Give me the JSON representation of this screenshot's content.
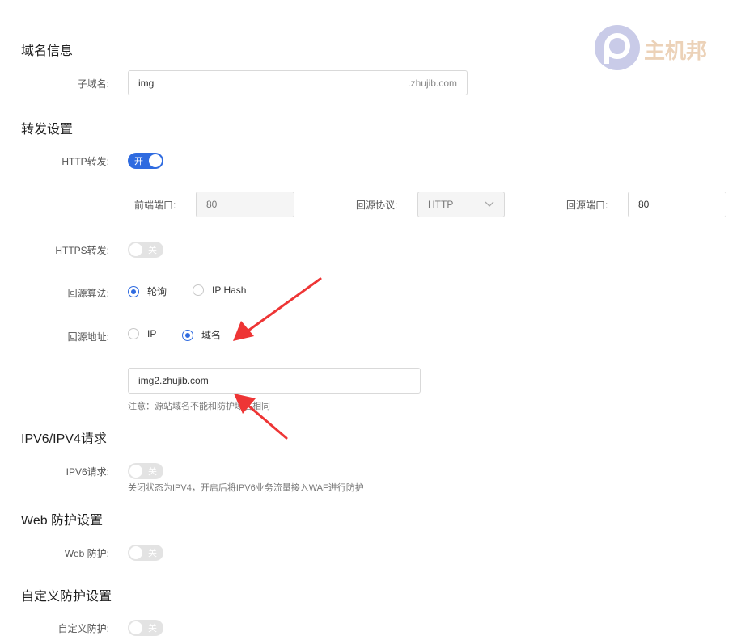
{
  "watermark": {
    "text": "主机邦"
  },
  "domain_info": {
    "title": "域名信息",
    "subdomain_label": "子域名:",
    "subdomain_value": "img",
    "subdomain_suffix": ".zhujib.com"
  },
  "forwarding": {
    "title": "转发设置",
    "http_label": "HTTP转发:",
    "http_switch": "开",
    "frontend_port_label": "前端端口:",
    "frontend_port_value": "80",
    "origin_protocol_label": "回源协议:",
    "origin_protocol_value": "HTTP",
    "origin_port_label": "回源端口:",
    "origin_port_value": "80",
    "https_label": "HTTPS转发:",
    "https_switch": "关",
    "algorithm_label": "回源算法:",
    "algorithm_options": [
      "轮询",
      "IP Hash"
    ],
    "address_label": "回源地址:",
    "address_options": [
      "IP",
      "域名"
    ],
    "address_value": "img2.zhujib.com",
    "address_hint": "注意：源站域名不能和防护域名相同"
  },
  "ipv6": {
    "title": "IPV6/IPV4请求",
    "label": "IPV6请求:",
    "switch": "关",
    "hint": "关闭状态为IPV4，开启后将IPV6业务流量接入WAF进行防护"
  },
  "web_protection": {
    "title": "Web 防护设置",
    "label": "Web 防护:",
    "switch": "关"
  },
  "custom_protection": {
    "title": "自定义防护设置",
    "label": "自定义防护:",
    "switch": "关"
  },
  "colors": {
    "accent": "#2f6be0",
    "annotation": "#ee3535"
  }
}
